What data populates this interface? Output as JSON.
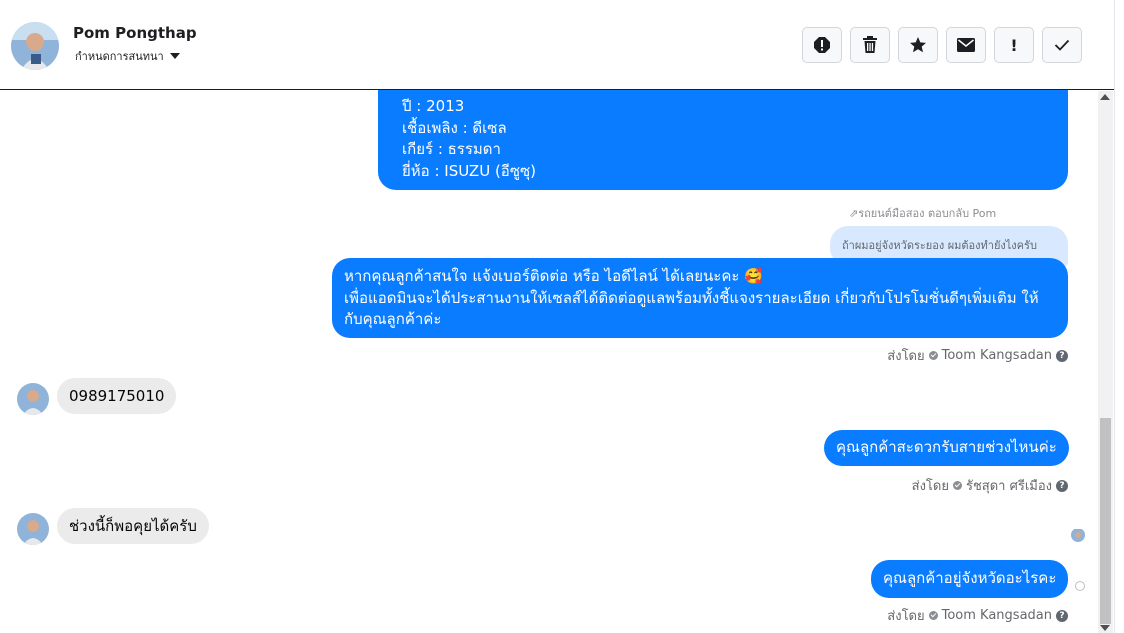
{
  "header": {
    "name": "Pom Pongthap",
    "assign_label": "กำหนดการสนทนา",
    "toolbar_icons": [
      "alert-circle-icon",
      "trash-icon",
      "star-icon",
      "mail-icon",
      "exclamation-icon",
      "checkmark-icon"
    ],
    "toolbar_glyphs": [
      "!",
      "🗑",
      "★",
      "✉",
      "!",
      "✓"
    ]
  },
  "messages": {
    "car_details": [
      "ปี : 2013",
      "เชื้อเพลิง : ดีเซล",
      "เกียร์ : ธรรมดา",
      "ยี่ห้อ : ISUZU (อีซูซุ)"
    ],
    "reply_label": "รถยนต์มือสอง ตอบกลับ Pom",
    "reply_quote": "ถ้าผมอยู่จังหวัดระยอง ผมต้องทำยังไงครับ",
    "agent_msg_1": "หากคุณลูกค้าสนใจ แจ้งเบอร์ติดต่อ หรือ ไอดีไลน์ ได้เลยนะคะ 🥰\nเพื่อแอดมินจะได้ประสานงานให้เซลส์ได้ติดต่อดูแลพร้อมทั้งชี้แจงรายละเอียด เกี่ยวกับโปรโมชั่นดีๆเพิ่มเติม ให้กับคุณลูกค้าค่ะ",
    "sent_by_label": "ส่งโดย",
    "sender_1": "Toom Kangsadan",
    "customer_msg_1": "0989175010",
    "agent_msg_2": "คุณลูกค้าสะดวกรับสายช่วงไหนค่ะ",
    "sender_2": "รัชสุดา ศรีเมือง",
    "customer_msg_2": "ช่วงนี้ก็พอคุยได้ครับ",
    "agent_msg_3": "คุณลูกค้าอยู่จังหวัดอะไรคะ",
    "sender_3": "Toom Kangsadan"
  },
  "colors": {
    "outgoing_bubble": "#0a7cff",
    "incoming_bubble": "#ebebeb",
    "reply_bubble": "#d8e9ff"
  }
}
